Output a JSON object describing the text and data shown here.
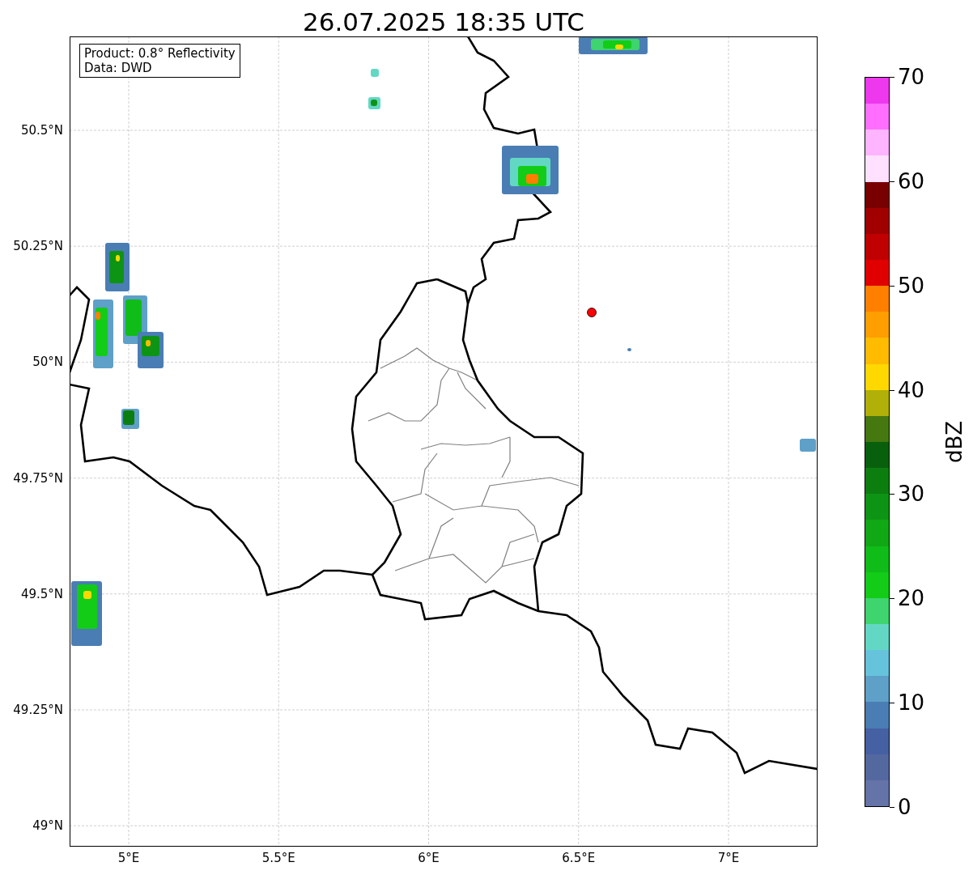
{
  "title": "26.07.2025 18:35 UTC",
  "info_box": {
    "lines": [
      "Product: 0.8° Reflectivity",
      "Data: DWD"
    ]
  },
  "map": {
    "y_ticks": [
      "50.5°N",
      "50.25°N",
      "50°N",
      "49.75°N",
      "49.5°N",
      "49.25°N",
      "49°N"
    ],
    "x_ticks": [
      "5°E",
      "5.5°E",
      "6°E",
      "6.5°E",
      "7°E"
    ]
  },
  "colorbar": {
    "label": "dBZ",
    "ticks": [
      "70",
      "60",
      "50",
      "40",
      "30",
      "20",
      "10",
      "0"
    ],
    "bands": [
      {
        "color": "#ee38ee"
      },
      {
        "color": "#ff6eff"
      },
      {
        "color": "#ffb4ff"
      },
      {
        "color": "#ffe0ff"
      },
      {
        "color": "#780000"
      },
      {
        "color": "#a00000"
      },
      {
        "color": "#c00000"
      },
      {
        "color": "#e00000"
      },
      {
        "color": "#ff8000"
      },
      {
        "color": "#ff9e00"
      },
      {
        "color": "#ffbb00"
      },
      {
        "color": "#ffd800"
      },
      {
        "color": "#b0b008"
      },
      {
        "color": "#467810"
      },
      {
        "color": "#08600c"
      },
      {
        "color": "#0c7e10"
      },
      {
        "color": "#0e9414"
      },
      {
        "color": "#10a814"
      },
      {
        "color": "#10bc18"
      },
      {
        "color": "#12cc18"
      },
      {
        "color": "#3ed46e"
      },
      {
        "color": "#62d8c4"
      },
      {
        "color": "#66c3dc"
      },
      {
        "color": "#5ea0c8"
      },
      {
        "color": "#4a7db4"
      },
      {
        "color": "#4660a4"
      },
      {
        "color": "#5468a0"
      },
      {
        "color": "#6473a8"
      }
    ]
  }
}
